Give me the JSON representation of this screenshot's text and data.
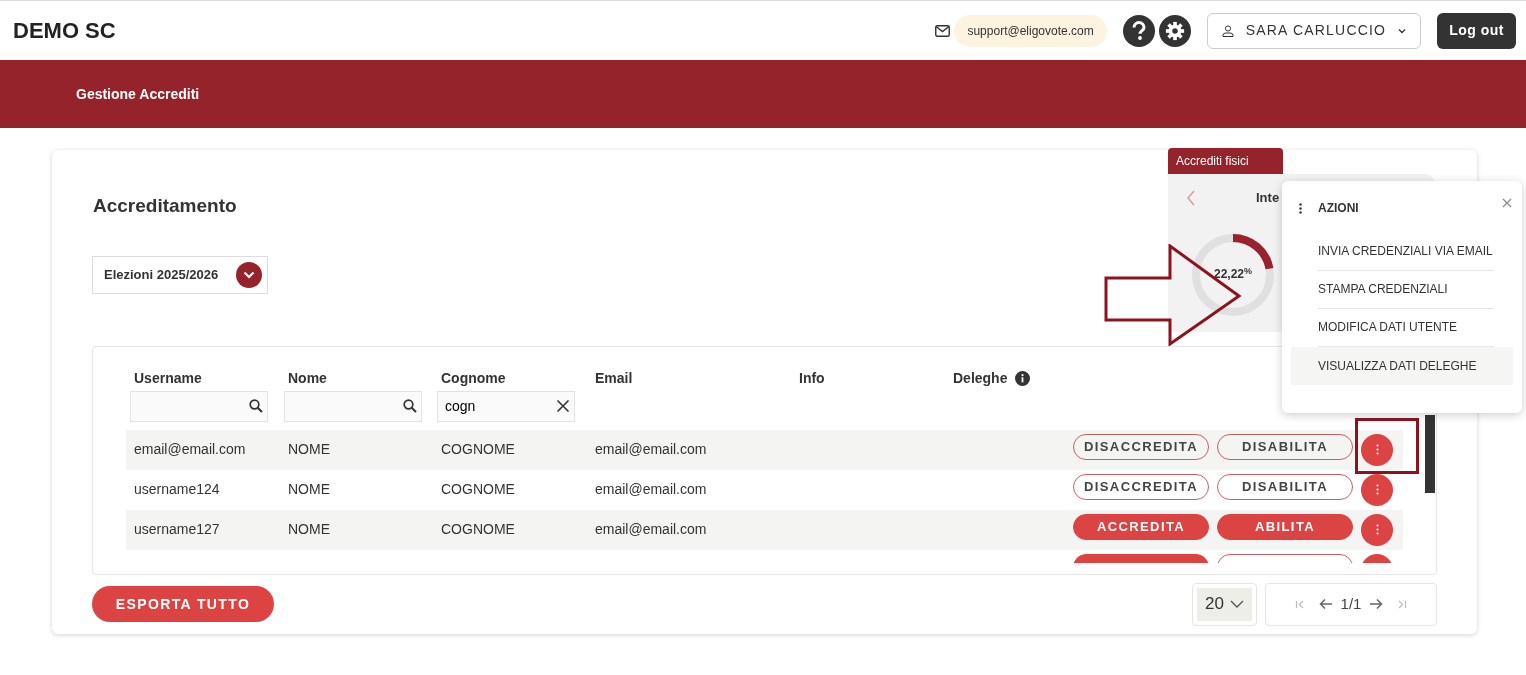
{
  "header": {
    "brand": "DEMO SC",
    "support_email": "support@eligovote.com",
    "user": "SARA CARLUCCIO",
    "logout": "Log out"
  },
  "nav": {
    "items": [
      {
        "label": "Gestione Accrediti",
        "selected": true
      }
    ]
  },
  "page": {
    "title": "Accreditamento",
    "election_select": "Elezioni 2025/2026"
  },
  "stats": {
    "tab": "Accrediti fisici",
    "title": "Inte",
    "gauge": {
      "level": 0.2222,
      "value": "22,22$^{%}$"
    }
  },
  "table": {
    "columns": [
      {
        "label": "Username",
        "filter": {
          "kind": "search"
        }
      },
      {
        "label": "Nome",
        "filter": {
          "kind": "search"
        }
      },
      {
        "label": "Cognome",
        "filter": {
          "kind": "clear",
          "value": "cogn"
        }
      },
      {
        "label": "Email"
      },
      {
        "label": "Info"
      },
      {
        "label": "Deleghe",
        "info": true
      }
    ],
    "rows": [
      {
        "cells": [
          "email@email.com",
          "NOME",
          "COGNOME",
          "email@email.com",
          "",
          ""
        ],
        "actions": [
          {
            "label": "DISACCREDITA",
            "kind": "outline"
          },
          {
            "label": "DISABILITA",
            "kind": "outline"
          }
        ]
      },
      {
        "cells": [
          "username124",
          "NOME",
          "COGNOME",
          "email@email.com",
          "",
          ""
        ],
        "actions": [
          {
            "label": "DISACCREDITA",
            "kind": "outline"
          },
          {
            "label": "DISABILITA",
            "kind": "outline"
          }
        ]
      },
      {
        "cells": [
          "username127",
          "NOME",
          "COGNOME",
          "email@email.com",
          "",
          ""
        ],
        "actions": [
          {
            "label": "ACCREDITA",
            "kind": "filled"
          },
          {
            "label": "ABILITA",
            "kind": "filled"
          }
        ]
      },
      {
        "cells": [
          "",
          "",
          "",
          "",
          "",
          ""
        ],
        "actions": [
          {
            "kind": "filled"
          },
          {
            "kind": "outline"
          }
        ]
      }
    ]
  },
  "export_button": "ESPORTA TUTTO",
  "pagination": {
    "page_size": "20",
    "page": "1/1"
  },
  "actions_menu": {
    "title": "AZIONI",
    "items": [
      {
        "label": "INVIA CREDENZIALI VIA EMAIL",
        "selected": false
      },
      {
        "label": "STAMPA CREDENZIALI",
        "selected": false
      },
      {
        "label": "MODIFICA DATI UTENTE",
        "selected": false
      },
      {
        "label": "VISUALIZZA DATI DELEGHE",
        "selected": true
      }
    ]
  }
}
